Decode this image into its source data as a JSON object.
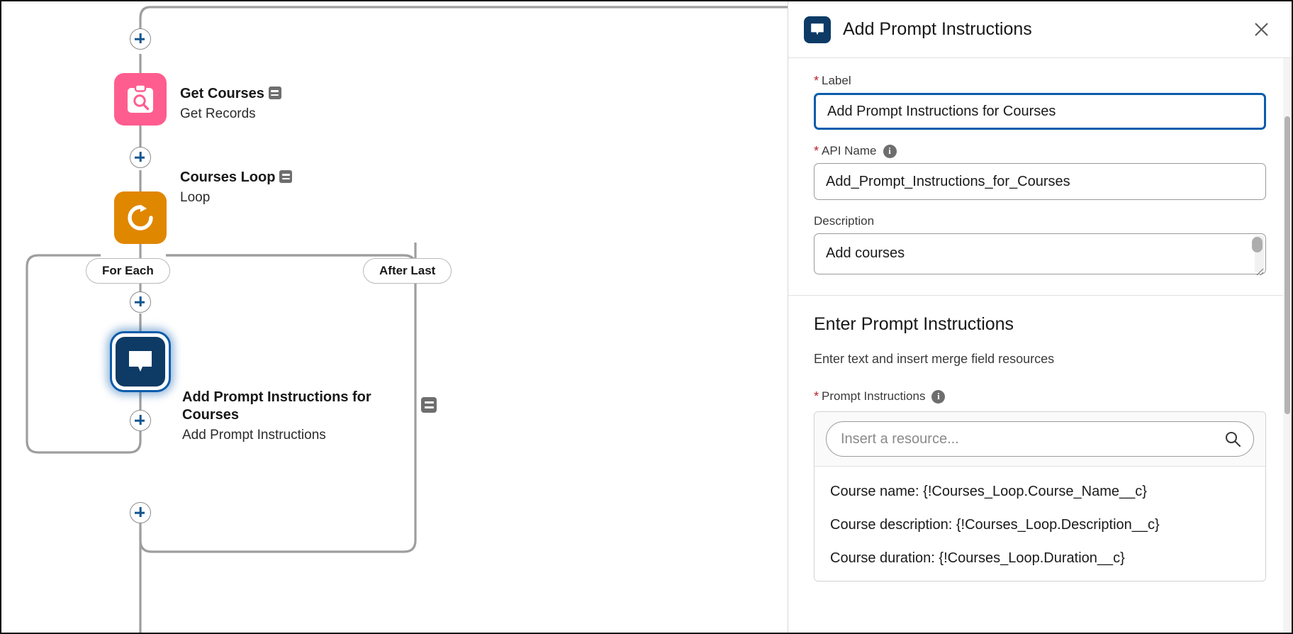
{
  "canvas": {
    "nodes": [
      {
        "id": "get-courses",
        "title": "Get Courses",
        "subtitle": "Get Records",
        "icon": "clipboard-search-icon",
        "color": "#ff5d8f",
        "has_description_badge": true
      },
      {
        "id": "courses-loop",
        "title": "Courses Loop",
        "subtitle": "Loop",
        "icon": "loop-refresh-icon",
        "color": "#e08700",
        "has_description_badge": true
      },
      {
        "id": "add-prompt-instructions-for-courses",
        "title": "Add Prompt Instructions for Courses",
        "subtitle": "Add Prompt Instructions",
        "icon": "speech-bubble-icon",
        "color": "#0d3b66",
        "selected": true,
        "has_description_badge": true
      }
    ],
    "branch_labels": {
      "for_each": "For Each",
      "after_last": "After Last"
    },
    "add_element_label": "+"
  },
  "panel": {
    "title": "Add Prompt Instructions",
    "icon": "speech-bubble-icon",
    "close_label": "✕",
    "accent_color": "#0b5cab",
    "required_marker": "*",
    "info_marker": "i",
    "fields": {
      "label": {
        "label": "Label",
        "value": "Add Prompt Instructions for Courses",
        "required": true,
        "focused": true
      },
      "api_name": {
        "label": "API Name",
        "value": "Add_Prompt_Instructions_for_Courses",
        "required": true,
        "has_info": true
      },
      "description": {
        "label": "Description",
        "value": "Add courses",
        "required": false
      }
    },
    "section": {
      "title": "Enter Prompt Instructions",
      "description": "Enter text and insert merge field resources",
      "prompt_instructions": {
        "label": "Prompt Instructions",
        "required": true,
        "has_info": true,
        "search_placeholder": "Insert a resource...",
        "search_value": "",
        "search_icon": "search-icon",
        "lines": [
          "Course name: {!Courses_Loop.Course_Name__c}",
          "Course description: {!Courses_Loop.Description__c}",
          "Course duration: {!Courses_Loop.Duration__c}"
        ]
      }
    }
  }
}
